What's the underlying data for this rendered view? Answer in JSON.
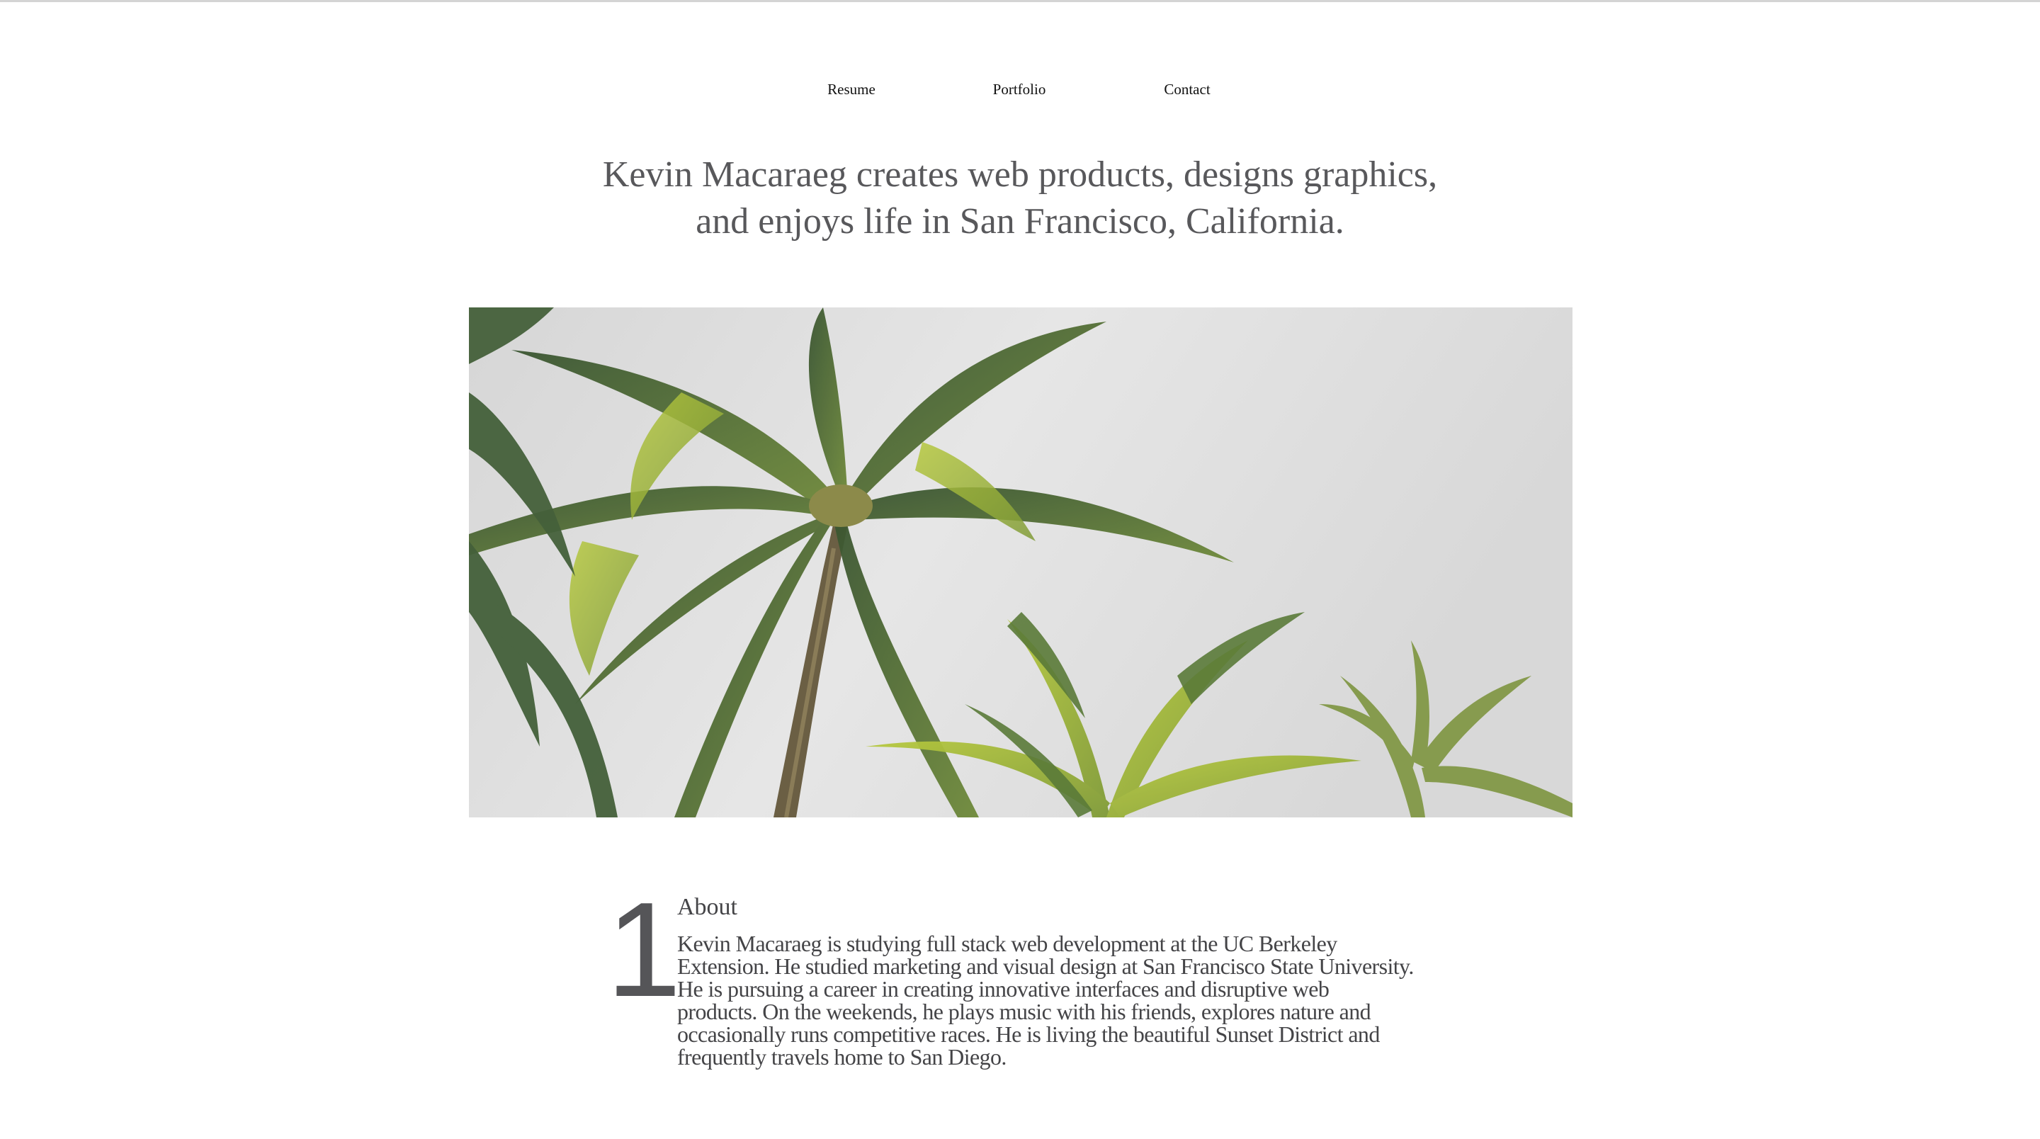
{
  "nav": {
    "items": [
      {
        "label": "Resume"
      },
      {
        "label": "Portfolio"
      },
      {
        "label": "Contact"
      }
    ]
  },
  "headline": {
    "line1": "Kevin Macaraeg creates web products, designs graphics,",
    "line2": "and enjoys life in San Francisco, California."
  },
  "hero": {
    "subject": "palm-trees-photo",
    "colors": {
      "sky": "#dedede",
      "frond_dark": "#3f5a34",
      "frond_light": "#a8bf3a",
      "trunk": "#6b5f44"
    }
  },
  "about": {
    "number": "1",
    "heading": "About",
    "body": "Kevin Macaraeg is studying full stack web development at the UC Berkeley Extension. He studied marketing and visual design at San Francisco State University. He is pursuing a career in creating innovative interfaces and disruptive web products. On the weekends, he plays music with his friends, explores nature and occasionally runs competitive races. He is living the beautiful Sunset District and frequently travels home to San Diego."
  }
}
